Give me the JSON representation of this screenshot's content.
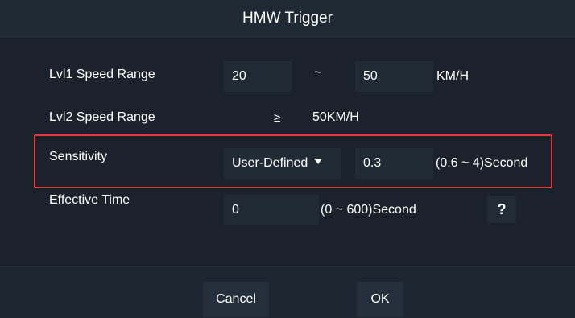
{
  "dialog": {
    "title": "HMW Trigger"
  },
  "rows": {
    "lvl1": {
      "label": "Lvl1 Speed Range",
      "min_value": "20",
      "separator": "~",
      "max_value": "50",
      "unit": "KM/H"
    },
    "lvl2": {
      "label": "Lvl2 Speed Range",
      "symbol": "≥",
      "value": "50KM/H"
    },
    "sensitivity": {
      "label": "Sensitivity",
      "mode_selected": "User-Defined",
      "value": "0.3",
      "range_hint": "(0.6 ~ 4)Second"
    },
    "effective_time": {
      "label": "Effective Time",
      "value": "0",
      "range_hint": "(0 ~ 600)Second",
      "help_label": "?"
    }
  },
  "footer": {
    "cancel_label": "Cancel",
    "ok_label": "OK"
  },
  "colors": {
    "highlight": "#e53935",
    "background": "#1a222c",
    "field": "#212b36"
  },
  "icons": {
    "dropdown": "caret-down-icon"
  }
}
